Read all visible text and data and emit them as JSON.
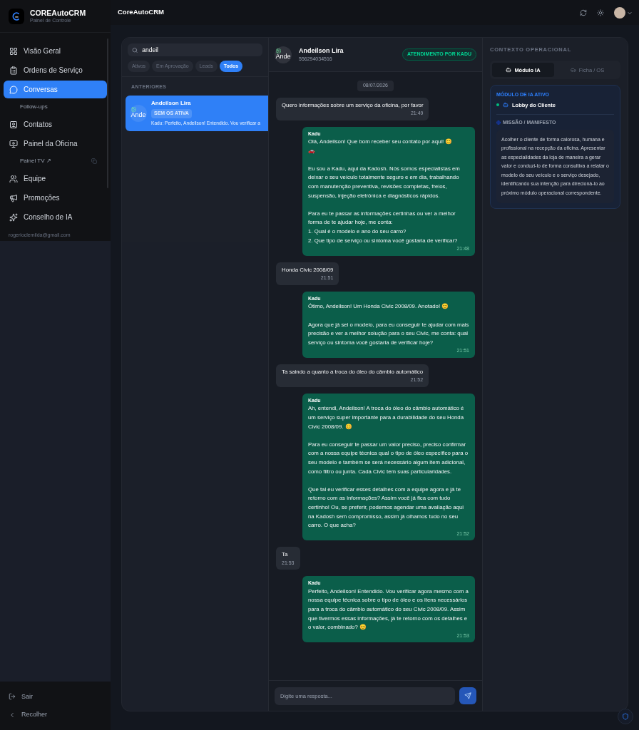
{
  "sidebar": {
    "brand": "COREAutoCRM",
    "subtitle": "Painel de Controle",
    "items": [
      {
        "kind": "main",
        "label": "Visão Geral",
        "selected": false
      },
      {
        "kind": "main",
        "label": "Ordens de Serviço",
        "selected": false
      },
      {
        "kind": "main",
        "label": "Conversas",
        "selected": true
      },
      {
        "kind": "sub",
        "label": "Follow-ups",
        "selected": false
      },
      {
        "kind": "main",
        "label": "Contatos",
        "selected": false
      },
      {
        "kind": "main",
        "label": "Painel da Oficina",
        "selected": false
      },
      {
        "kind": "sublink",
        "label": "Painel TV ↗",
        "selected": false
      },
      {
        "kind": "main",
        "label": "Equipe",
        "selected": false
      },
      {
        "kind": "main",
        "label": "Promoções",
        "selected": false
      },
      {
        "kind": "main",
        "label": "Conselho de IA",
        "selected": false
      }
    ],
    "user_email": "rogerioclemilda@gmail.com",
    "footer": [
      {
        "label": "Sair"
      },
      {
        "label": "Recolher"
      }
    ]
  },
  "header": {
    "title": "CoreAutoCRM"
  },
  "conversations": {
    "search": {
      "value": "andeil"
    },
    "filters": [
      {
        "label": "Ativos",
        "selected": false
      },
      {
        "label": "Em Aprovação",
        "selected": false
      },
      {
        "label": "Leads",
        "selected": false
      },
      {
        "label": "Todos",
        "selected": true
      }
    ],
    "section": "ANTERIORES",
    "items": [
      {
        "name": "Andeilson Lira",
        "avatar_text": "Ande",
        "badge": "SEM OS ATIVA",
        "preview": "Kadu: Perfeito, Andeilson! Entendido. Vou verificar a",
        "selected": true
      }
    ]
  },
  "chat": {
    "name": "Andeilson Lira",
    "avatar_text": "Ande",
    "phone": "556294034516",
    "status": "ATENDIMENTO POR KADU",
    "date": "08/07/2026",
    "messages": [
      {
        "kind": "received",
        "text": "Quero informações sobre um serviço da oficina, por favor",
        "time": "21:49"
      },
      {
        "kind": "sent",
        "sender": "Kadu",
        "text": "Olá, Andeilson! Que bom receber seu contato por aqui! 😊\n🚗\n\nEu sou a Kadu, aqui da Kadosh. Nós somos especialistas em deixar o seu veículo totalmente seguro e em dia, trabalhando com manutenção preventiva, revisões completas, freios, suspensão, injeção eletrônica e diagnósticos rápidos.\n\nPara eu te passar as informações certinhas ou ver a melhor forma de te ajudar hoje, me conta:\n1. Qual é o modelo e ano do seu carro?\n2. Que tipo de serviço ou sintoma você gostaria de verificar?",
        "time": "21:48"
      },
      {
        "kind": "received",
        "text": "Honda Civic 2008/09",
        "time": "21:51"
      },
      {
        "kind": "sent",
        "sender": "Kadu",
        "text": "Ótimo, Andeilson! Um Honda Civic 2008/09. Anotado! 😊\n\nAgora que já sei o modelo, para eu conseguir te ajudar com mais precisão e ver a melhor solução para o seu Civic, me conta: qual serviço ou sintoma você gostaria de verificar hoje?",
        "time": "21:51"
      },
      {
        "kind": "received",
        "text": "Ta saindo a quanto a troca do óleo do câmbio automático",
        "time": "21:52"
      },
      {
        "kind": "sent",
        "sender": "Kadu",
        "text": "Ah, entendi, Andeilson! A troca do óleo do câmbio automático é um serviço super importante para a durabilidade do seu Honda Civic 2008/09. 😊\n\nPara eu conseguir te passar um valor preciso, preciso confirmar com a nossa equipe técnica qual o tipo de óleo específico para o seu modelo e também se será necessário algum item adicional, como filtro ou junta. Cada Civic tem suas particularidades.\n\nQue tal eu verificar esses detalhes com a equipe agora e já te retorno com as informações? Assim você já fica com tudo certinho! Ou, se preferir, podemos agendar uma avaliação aqui na Kadosh sem compromisso, assim já olhamos tudo no seu carro. O que acha?",
        "time": "21:52"
      },
      {
        "kind": "received",
        "text": "Ta",
        "time": "21:53"
      },
      {
        "kind": "sent",
        "sender": "Kadu",
        "text": "Perfeito, Andeilson! Entendido. Vou verificar agora mesmo com a nossa equipe técnica sobre o tipo de óleo e os itens necessários para a troca do câmbio automático do seu Civic 2008/09. Assim que tivermos essas informações, já te retorno com os detalhes e o valor, combinado? 😊",
        "time": "21:53"
      }
    ],
    "composer": {
      "placeholder": "Digite uma resposta..."
    }
  },
  "context": {
    "title": "CONTEXTO OPERACIONAL",
    "tabs": [
      {
        "label": "Módulo IA",
        "selected": true
      },
      {
        "label": "Ficha / OS",
        "selected": false
      }
    ],
    "module_label": "MÓDULO DE IA ATIVO",
    "module_name": "Lobby do Cliente",
    "module_active": true,
    "mission_label": "MISSÃO / MANIFESTO",
    "mission": "Acolher o cliente de forma calorosa, humana e profissional na recepção da oficina. Apresentar as especialidades da loja de maneira a gerar valor e conduzi-lo de forma consultiva a relatar o modelo do seu veículo e o serviço desejado, identificando sua intenção para direcioná-lo ao próximo módulo operacional correspondente."
  }
}
